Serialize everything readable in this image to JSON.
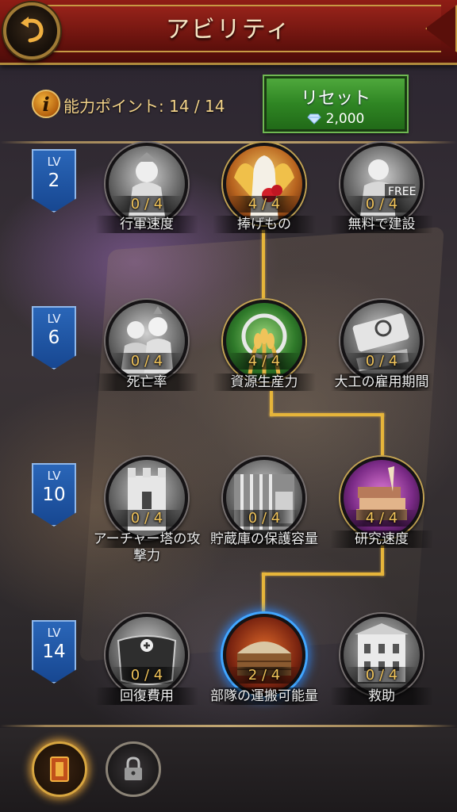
{
  "header": {
    "title": "アビリティ"
  },
  "points": {
    "label": "能力ポイント: 14 / 14"
  },
  "reset": {
    "label": "リセット",
    "cost": "2,000"
  },
  "tiers": [
    {
      "lv": "LV",
      "level": "2",
      "skills": [
        {
          "name": "行軍速度",
          "count": "0 / 4",
          "icon": "soldier-icon"
        },
        {
          "name": "捧げもの",
          "count": "4 / 4",
          "icon": "angel-offering-icon"
        },
        {
          "name": "無料で建設",
          "count": "0 / 4",
          "icon": "builder-free-icon"
        }
      ]
    },
    {
      "lv": "LV",
      "level": "6",
      "skills": [
        {
          "name": "死亡率",
          "count": "0 / 4",
          "icon": "warriors-icon"
        },
        {
          "name": "資源生産力",
          "count": "4 / 4",
          "icon": "wheat-icon"
        },
        {
          "name": "大工の雇用期間",
          "count": "0 / 4",
          "icon": "saw-icon"
        }
      ]
    },
    {
      "lv": "LV",
      "level": "10",
      "skills": [
        {
          "name": "アーチャー塔の攻撃力",
          "count": "0 / 4",
          "icon": "tower-icon"
        },
        {
          "name": "貯蔵庫の保護容量",
          "count": "0 / 4",
          "icon": "vault-icon"
        },
        {
          "name": "研究速度",
          "count": "4 / 4",
          "icon": "books-icon"
        }
      ]
    },
    {
      "lv": "LV",
      "level": "14",
      "skills": [
        {
          "name": "回復費用",
          "count": "0 / 4",
          "icon": "medkit-icon"
        },
        {
          "name": "部隊の運搬可能量",
          "count": "2 / 4",
          "icon": "wagon-icon"
        },
        {
          "name": "救助",
          "count": "0 / 4",
          "icon": "building-icon"
        }
      ]
    }
  ],
  "tabs": [
    {
      "icon": "book-icon",
      "active": true
    },
    {
      "icon": "lock-icon",
      "active": false
    }
  ],
  "colors": {
    "accent_gold": "#e6b53a",
    "header_red": "#8e1d15",
    "button_green": "#2f8523",
    "badge_blue": "#174791"
  }
}
